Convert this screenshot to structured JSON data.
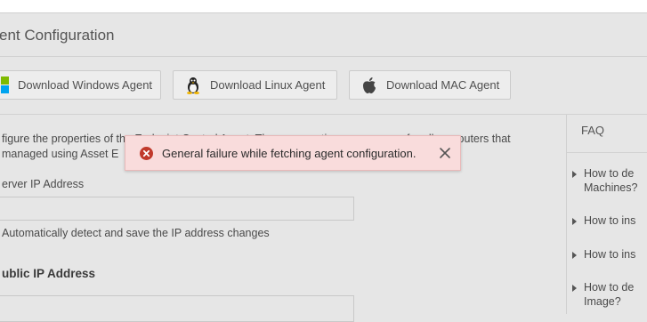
{
  "page": {
    "title": "ent Configuration"
  },
  "download_buttons": [
    {
      "label": "Download Windows Agent",
      "icon": "windows-icon"
    },
    {
      "label": "Download Linux Agent",
      "icon": "linux-icon"
    },
    {
      "label": "Download MAC Agent",
      "icon": "apple-icon"
    }
  ],
  "main": {
    "description_line1": "figure the properties of the Endpoint Central Agent. These properties are common for all computers that",
    "description_line2": "managed using  Asset E",
    "server_ip_label": "erver IP Address",
    "server_ip_value": "",
    "auto_detect_label": "Automatically detect and save the IP address changes",
    "public_ip_heading": "ublic IP Address",
    "public_ip_value": ""
  },
  "faq": {
    "heading": "FAQ",
    "items": [
      {
        "line1": "How to de",
        "line2": "Machines?"
      },
      {
        "line1": "How to ins",
        "line2": ""
      },
      {
        "line1": "How to ins",
        "line2": ""
      },
      {
        "line1": "How to de",
        "line2": "Image?"
      }
    ]
  },
  "toast": {
    "message": "General failure while fetching agent configuration.",
    "type": "error",
    "icon": "error-circle-icon",
    "close_icon": "close-icon",
    "colors": {
      "background": "#f9dcdc",
      "icon": "#c0392b"
    }
  }
}
